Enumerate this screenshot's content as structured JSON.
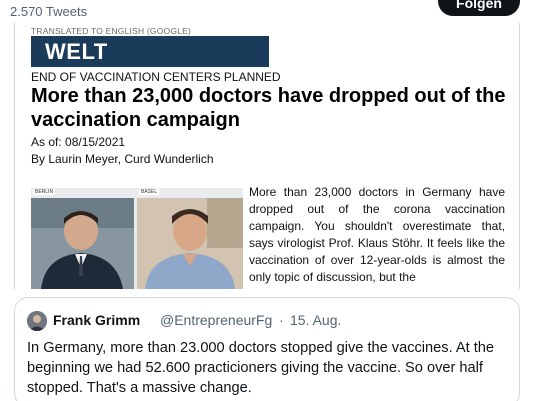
{
  "header": {
    "tweet_count": "2.570 Tweets",
    "follow_label": "Folgen"
  },
  "article_image": {
    "translated_label": "TRANSLATED TO ENGLISH (GOOGLE)",
    "logo": "WELT",
    "kicker": "END OF VACCINATION CENTERS PLANNED",
    "headline": "More than 23,000 doctors have dropped out of the vaccination campaign",
    "as_of": "As of: 08/15/2021",
    "byline": "By Laurin Meyer, Curd Wunderlich",
    "video_labels": [
      "BERLIN",
      "BASEL"
    ],
    "body": "More than 23,000 doctors in Germany have dropped out of the corona vaccination campaign. You shouldn't overestimate that, says virologist Prof. Klaus Stöhr. It feels like the vaccination of over 12-year-olds is almost the only topic of discussion, but the"
  },
  "quoted_tweet": {
    "author_name": "Frank Grimm",
    "handle": "@EntrepreneurFg",
    "separator": "·",
    "date": "15. Aug.",
    "text": "In Germany, more than 23.000 doctors stopped give the vaccines. At the beginning we had 52.600 practicioners giving the vaccine. So over half stopped. That's a massive change."
  }
}
